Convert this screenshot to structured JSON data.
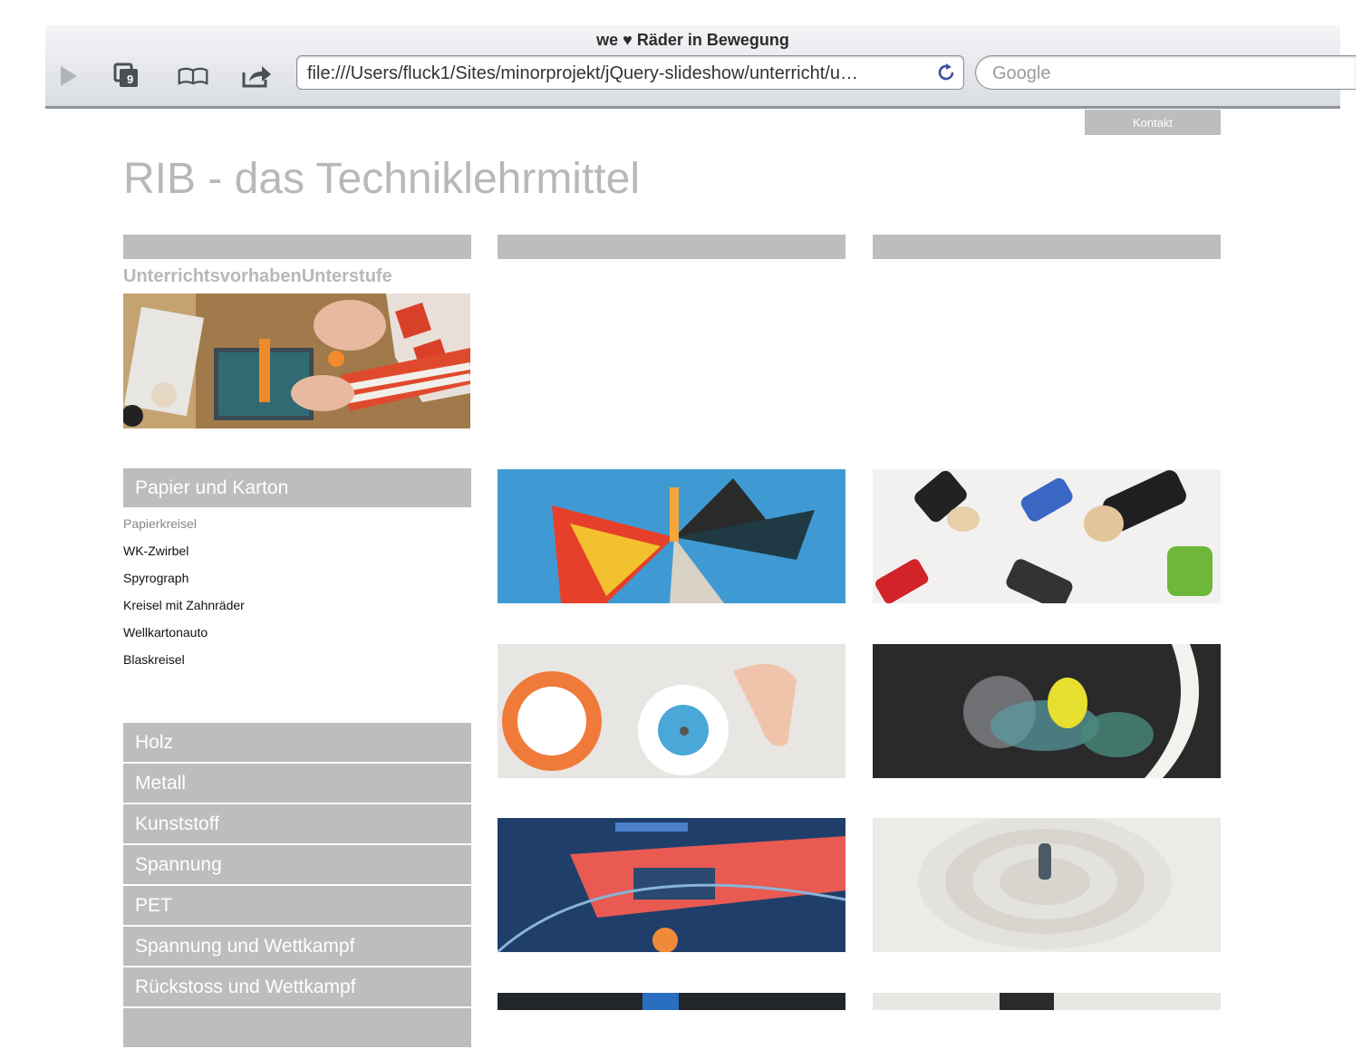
{
  "browser": {
    "window_title": "we ♥ Räder in Bewegung",
    "tab_count": "9",
    "url": "file:///Users/fluck1/Sites/minorprojekt/jQuery-slideshow/unterricht/u…",
    "search_placeholder": "Google",
    "icons": [
      "play-icon",
      "tabs-icon",
      "bookmarks-icon",
      "share-icon",
      "reload-icon"
    ]
  },
  "page": {
    "nav": {
      "kontakt_label": "Kontakt"
    },
    "title": "RIB - das Techniklehrmittel",
    "section_label": "UnterrichtsvorhabenUnterstufe",
    "open_category": {
      "label": "Papier und Karton",
      "items": [
        "Papierkreisel",
        "WK-Zwirbel",
        "Spyrograph",
        "Kreisel mit Zahnräder",
        "Wellkartonauto",
        "Blaskreisel"
      ],
      "active_index": 0
    },
    "categories": [
      "Holz",
      "Metall",
      "Kunststoff",
      "Spannung",
      "PET",
      "Spannung und Wettkampf",
      "Rückstoss und Wettkampf"
    ]
  },
  "colors": {
    "bar_gray": "#bdbdbf",
    "title_gray": "#b8b8ba",
    "text_dark": "#111111"
  }
}
